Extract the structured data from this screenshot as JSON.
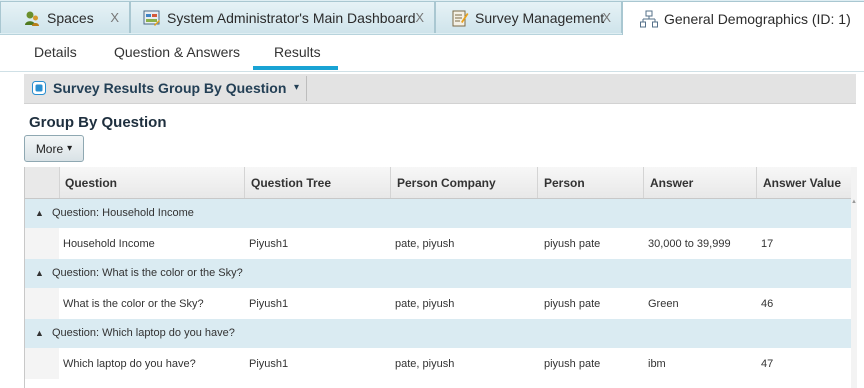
{
  "tabs": [
    {
      "label": "Spaces",
      "icon": "spaces-icon",
      "closable": true
    },
    {
      "label": "System Administrator's Main Dashboard",
      "icon": "dashboard-icon",
      "closable": true
    },
    {
      "label": "Survey Management",
      "icon": "survey-icon",
      "closable": true
    },
    {
      "label": "General Demographics (ID: 1)",
      "icon": "hierarchy-icon",
      "closable": false
    }
  ],
  "close_glyph": "X",
  "subtabs": [
    "Details",
    "Question & Answers",
    "Results"
  ],
  "active_subtab": "Results",
  "panel": {
    "title": "Survey Results Group By Question",
    "caret": "▾"
  },
  "group_heading": "Group By Question",
  "more_button": {
    "label": "More",
    "caret": "▾"
  },
  "grid": {
    "columns": [
      "Question",
      "Question Tree",
      "Person Company",
      "Person",
      "Answer",
      "Answer Value"
    ],
    "groups": [
      {
        "label": "Question: Household Income",
        "toggle": "▲",
        "rows": [
          [
            "Household Income",
            "Piyush1",
            "pate, piyush",
            "piyush pate",
            "30,000 to 39,999",
            "17"
          ]
        ]
      },
      {
        "label": "Question: What is the color or the Sky?",
        "toggle": "▲",
        "rows": [
          [
            "What is the color or the Sky?",
            "Piyush1",
            "pate, piyush",
            "piyush pate",
            "Green",
            "46"
          ]
        ]
      },
      {
        "label": "Question: Which laptop do you have?",
        "toggle": "▲",
        "rows": [
          [
            "Which laptop do you have?",
            "Piyush1",
            "pate, piyush",
            "piyush pate",
            "ibm",
            "47"
          ]
        ]
      }
    ]
  },
  "colors": {
    "accent": "#19a3d4",
    "group_row": "#daebf2",
    "heading": "#233f55"
  }
}
